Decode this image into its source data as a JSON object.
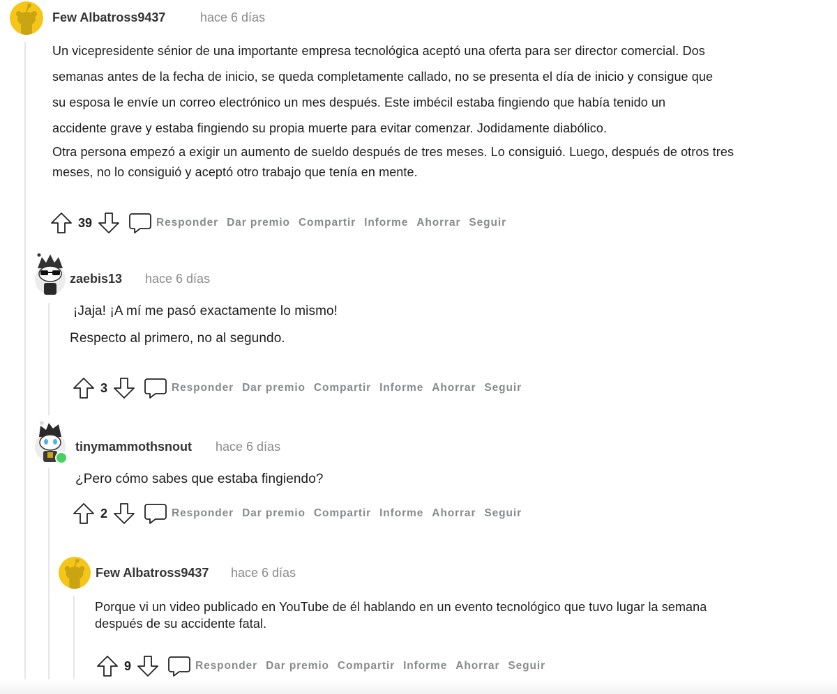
{
  "comments": [
    {
      "username": "Few Albatross9437",
      "time": "hace 6 días",
      "lines": [
        "Un vicepresidente sénior de una importante empresa tecnológica aceptó una oferta para ser director comercial. Dos",
        "semanas antes de la fecha de inicio, se queda completamente callado, no se presenta el día de inicio y consigue que",
        "su esposa le envíe un correo electrónico un mes después. Este imbécil estaba fingiendo que había tenido un",
        "accidente grave y estaba fingiendo su propia muerte para evitar comenzar. Jodidamente diabólico.",
        "Otra persona empezó a exigir un aumento de sueldo después de tres meses. Lo consiguió. Luego, después de otros tres",
        "meses, no lo consiguió y aceptó otro trabajo que tenía en mente."
      ],
      "score": "39"
    },
    {
      "username": "zaebis13",
      "time": "hace 6 días",
      "lines": [
        "¡Jaja! ¡A mí me pasó exactamente lo mismo!",
        "Respecto al primero, no al segundo."
      ],
      "score": "3"
    },
    {
      "username": "tinymammothsnout",
      "time": "hace 6 días",
      "lines": [
        "¿Pero cómo sabes que estaba fingiendo?"
      ],
      "score": "2"
    },
    {
      "username": "Few Albatross9437",
      "time": "hace 6 días",
      "lines": [
        "Porque vi un video publicado en YouTube de él hablando en un evento tecnológico que tuvo lugar la semana",
        "después de su accidente fatal."
      ],
      "score": "9"
    }
  ],
  "actions": {
    "reply": "Responder",
    "award": "Dar premio",
    "share": "Compartir",
    "report": "Informe",
    "save": "Ahorrar",
    "follow": "Seguir"
  },
  "icons": {
    "upvote": "upvote-arrow-icon",
    "downvote": "downvote-arrow-icon",
    "comment": "comment-bubble-icon",
    "online": "online-status-icon"
  },
  "colors": {
    "avatar_yellow": "#f5c518",
    "online_green": "#46d160",
    "action_gray": "#878a8c",
    "thread_line": "#e6e6e6"
  }
}
